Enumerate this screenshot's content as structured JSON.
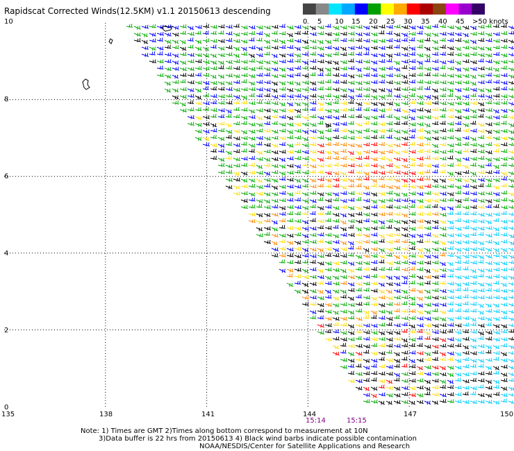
{
  "title": "Rapidscat Corrected Winds(12.5KM) v1.1 20150613 descending",
  "legend": {
    "labels": [
      "0",
      "5",
      "10",
      "15",
      "20",
      "25",
      "30",
      "35",
      "40",
      "45",
      ">50 knots"
    ],
    "colors": [
      "#444444",
      "#888888",
      "#00e5ff",
      "#00a8ff",
      "#0000ff",
      "#00a000",
      "#ffff00",
      "#ffaa00",
      "#ff0000",
      "#aa0000",
      "#8b4513",
      "#ff00ff",
      "#9900cc",
      "#330066"
    ]
  },
  "axes": {
    "y_ticks": [
      "10",
      "8",
      "6",
      "4",
      "2",
      "0"
    ],
    "x_ticks": [
      "135",
      "138",
      "141",
      "144",
      "147",
      "150"
    ]
  },
  "times": [
    "15:14",
    "15:15"
  ],
  "notes": [
    "Note: 1) Times are GMT 2)Times along bottom correspond to measurement at 10N",
    "3)Data buffer is 22 hrs from 20150613 4) Black wind barbs indicate possible contamination",
    "NOAA/NESDIS/Center for Satellite Applications and Research"
  ],
  "map": {
    "lon_range": [
      135,
      150
    ],
    "lat_range": [
      0,
      10
    ],
    "grid": true,
    "barb_colors": [
      "#0000ff",
      "#00aa00",
      "#ffdd00",
      "#ff8800",
      "#ff0000",
      "#aa0000",
      "#cc00cc",
      "#000000",
      "#00ccff"
    ]
  }
}
